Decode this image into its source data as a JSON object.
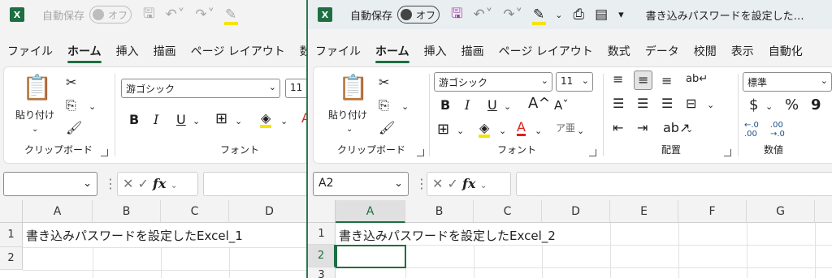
{
  "window1": {
    "app_logo": "X",
    "autosave_label": "自動保存",
    "autosave_state": "オフ",
    "tabs": [
      "ファイル",
      "ホーム",
      "挿入",
      "描画",
      "ページ レイアウト",
      "数"
    ],
    "active_tab": "ホーム",
    "clipboard": {
      "paste_label": "貼り付け",
      "group_label": "クリップボード"
    },
    "font": {
      "family": "游ゴシック",
      "size": "11",
      "group_label": "フォント",
      "bold": "B",
      "italic": "I",
      "underline": "U"
    },
    "column_headers": [
      "A",
      "B",
      "C",
      "D"
    ],
    "row_headers": [
      "1",
      "2"
    ],
    "cells": {
      "A1": "書き込みパスワードを設定したExcel_1"
    },
    "fx_label": "fx"
  },
  "window2": {
    "app_logo": "X",
    "autosave_label": "自動保存",
    "autosave_state": "オフ",
    "doc_title": "書き込みパスワードを設定した…",
    "tabs": [
      "ファイル",
      "ホーム",
      "挿入",
      "描画",
      "ページ レイアウト",
      "数式",
      "データ",
      "校閲",
      "表示",
      "自動化"
    ],
    "active_tab": "ホーム",
    "clipboard": {
      "paste_label": "貼り付け",
      "group_label": "クリップボード"
    },
    "font": {
      "family": "游ゴシック",
      "size": "11",
      "group_label": "フォント",
      "bold": "B",
      "italic": "I",
      "underline": "U",
      "grow": "A^",
      "shrink": "Aˇ"
    },
    "alignment": {
      "group_label": "配置"
    },
    "number": {
      "format": "標準",
      "group_label": "数値",
      "currency": "$",
      "percent": "%",
      "comma": "9",
      "inc_decimal": "←.0\n.00",
      "dec_decimal": ".00\n→.0"
    },
    "name_box": "A2",
    "fx_label": "fx",
    "column_headers": [
      "A",
      "B",
      "C",
      "D",
      "E",
      "F",
      "G"
    ],
    "row_headers": [
      "1",
      "2",
      "3"
    ],
    "cells": {
      "A1": "書き込みパスワードを設定したExcel_2"
    },
    "selected_cell": "A2"
  },
  "colors": {
    "excel_green": "#1d6f42",
    "highlight_yellow": "#f5e400",
    "font_red": "#e01e1e"
  }
}
